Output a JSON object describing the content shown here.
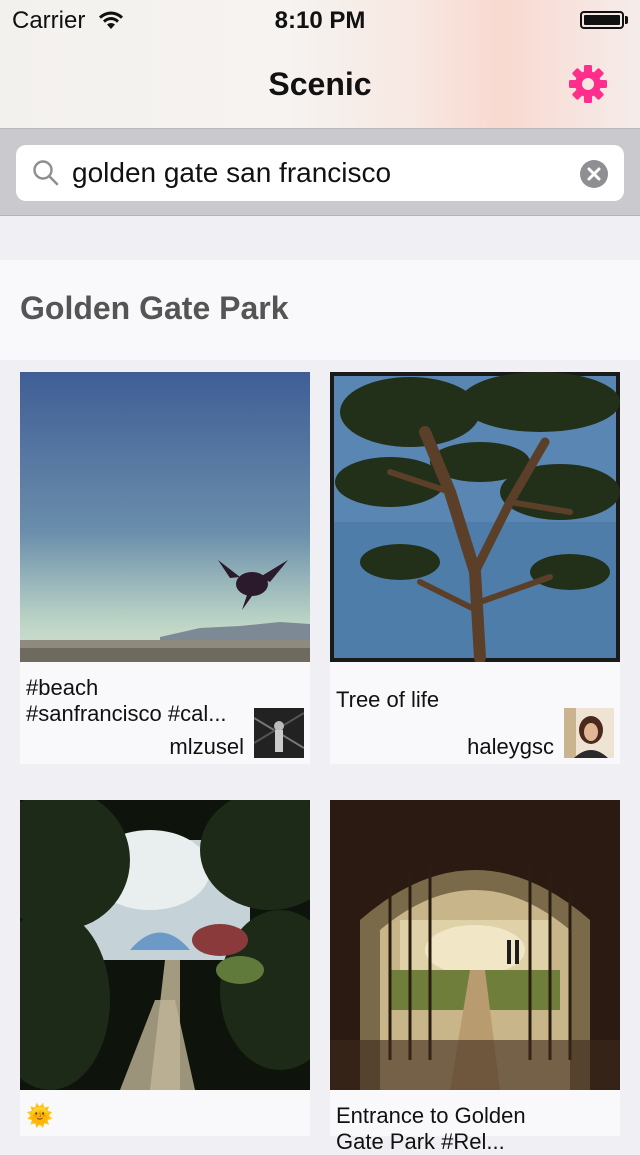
{
  "status_bar": {
    "carrier": "Carrier",
    "time": "8:10 PM"
  },
  "nav": {
    "title": "Scenic",
    "settings_icon": "gear-icon",
    "accent_color": "#ff2d8c"
  },
  "search": {
    "query": "golden gate san francisco",
    "search_icon": "search-icon",
    "clear_icon": "clear-icon"
  },
  "section": {
    "title": "Golden Gate Park"
  },
  "cards": [
    {
      "caption_line1": "#beach",
      "caption_line2": "#sanfrancisco #cal...",
      "username": "mlzusel"
    },
    {
      "caption_line1": "Tree of life",
      "caption_line2": "",
      "username": "haleygsc"
    },
    {
      "caption_line1": "🌞",
      "caption_line2": "",
      "username": ""
    },
    {
      "caption_line1": "Entrance to Golden",
      "caption_line2": "Gate Park #Rel...",
      "username": ""
    }
  ]
}
